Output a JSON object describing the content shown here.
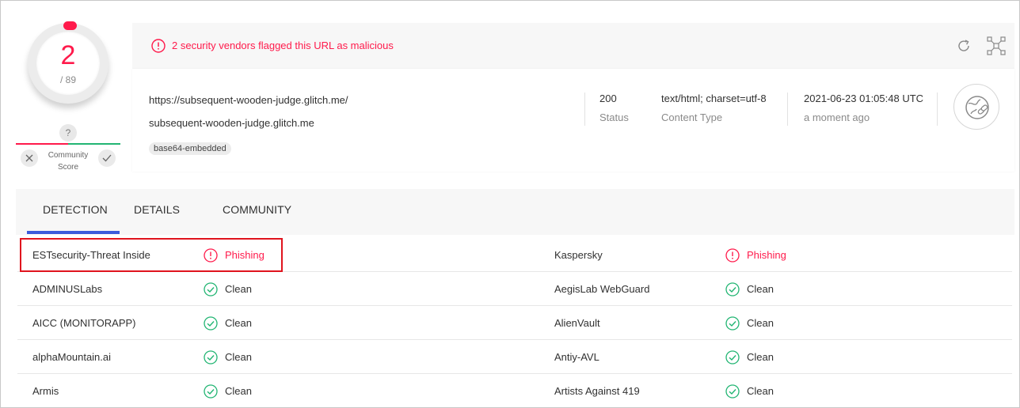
{
  "score": {
    "detections": "2",
    "total": "/ 89"
  },
  "community": {
    "question": "?",
    "label_line1": "Community",
    "label_line2": "Score"
  },
  "banner": {
    "message": "2 security vendors flagged this URL as malicious"
  },
  "info": {
    "url": "https://subsequent-wooden-judge.glitch.me/",
    "domain": "subsequent-wooden-judge.glitch.me",
    "tag": "base64-embedded",
    "status_value": "200",
    "status_label": "Status",
    "content_type_value": "text/html; charset=utf-8",
    "content_type_label": "Content Type",
    "date_value": "2021-06-23 01:05:48 UTC",
    "date_label": "a moment ago"
  },
  "tabs": [
    {
      "label": "DETECTION",
      "active": true
    },
    {
      "label": "DETAILS",
      "active": false
    },
    {
      "label": "COMMUNITY",
      "active": false
    }
  ],
  "detections": [
    {
      "left": {
        "vendor": "ESTsecurity-Threat Inside",
        "result": "Phishing",
        "status": "malicious"
      },
      "right": {
        "vendor": "Kaspersky",
        "result": "Phishing",
        "status": "malicious"
      }
    },
    {
      "left": {
        "vendor": "ADMINUSLabs",
        "result": "Clean",
        "status": "clean"
      },
      "right": {
        "vendor": "AegisLab WebGuard",
        "result": "Clean",
        "status": "clean"
      }
    },
    {
      "left": {
        "vendor": "AICC (MONITORAPP)",
        "result": "Clean",
        "status": "clean"
      },
      "right": {
        "vendor": "AlienVault",
        "result": "Clean",
        "status": "clean"
      }
    },
    {
      "left": {
        "vendor": "alphaMountain.ai",
        "result": "Clean",
        "status": "clean"
      },
      "right": {
        "vendor": "Antiy-AVL",
        "result": "Clean",
        "status": "clean"
      }
    },
    {
      "left": {
        "vendor": "Armis",
        "result": "Clean",
        "status": "clean"
      },
      "right": {
        "vendor": "Artists Against 419",
        "result": "Clean",
        "status": "clean"
      }
    }
  ],
  "colors": {
    "malicious": "#ff1a4b",
    "clean": "#22b573",
    "accent": "#3b5bdb"
  },
  "icons": {
    "banner": "alert-circle-icon",
    "refresh": "refresh-icon",
    "graph": "graph-icon",
    "avatar": "globe-link-icon",
    "malicious": "alert-circle-icon",
    "clean": "check-circle-icon"
  }
}
